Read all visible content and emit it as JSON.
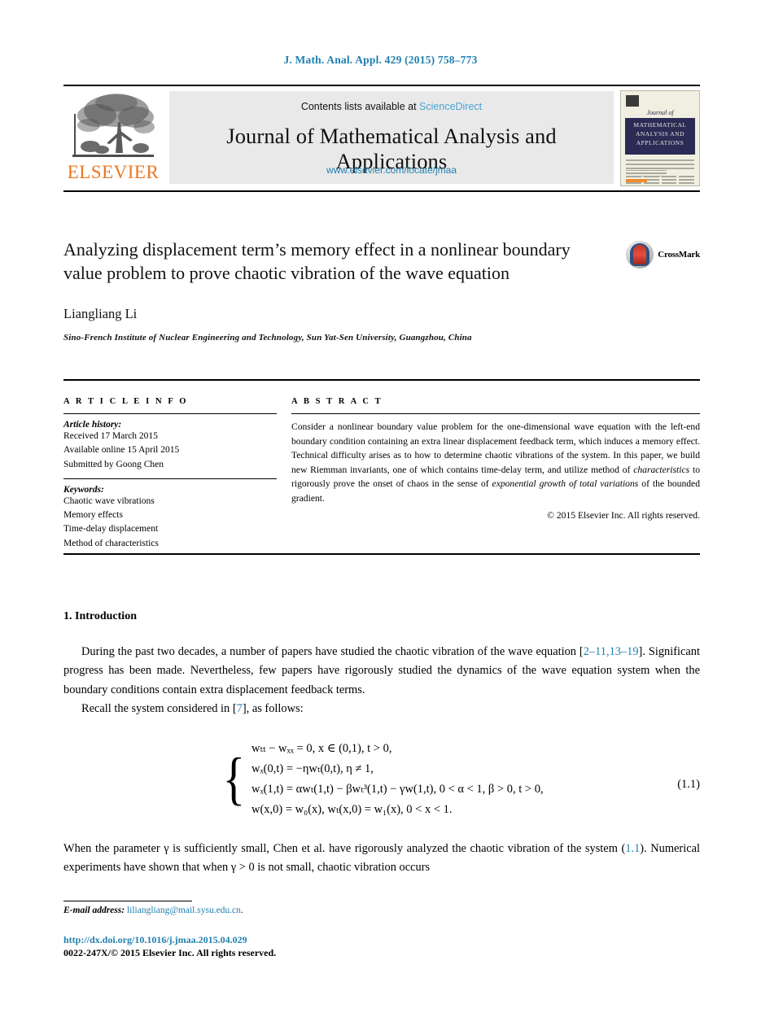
{
  "running_head": "J. Math. Anal. Appl. 429 (2015) 758–773",
  "masthead": {
    "contents_prefix": "Contents lists available at",
    "sciencedirect": "ScienceDirect",
    "journal_title": "Journal of Mathematical Analysis and Applications",
    "journal_url": "www.elsevier.com/locate/jmaa",
    "publisher": "ELSEVIER",
    "cover": {
      "journal_of": "Journal of",
      "band_line1": "MATHEMATICAL",
      "band_line2": "ANALYSIS AND",
      "band_line3": "APPLICATIONS"
    }
  },
  "title_block": {
    "title": "Analyzing displacement term’s memory effect in a nonlinear boundary value problem to prove chaotic vibration of the wave equation",
    "crossmark_label": "CrossMark",
    "author": "Liangliang Li",
    "affiliation": "Sino-French Institute of Nuclear Engineering and Technology, Sun Yat-Sen University, Guangzhou, China"
  },
  "article_info": {
    "heading": "A R T I C L E  I N F O",
    "history_label": "Article history:",
    "received": "Received 17 March 2015",
    "available_online": "Available online 15 April 2015",
    "submitted_by": "Submitted by Goong Chen",
    "keywords_label": "Keywords:",
    "keywords": [
      "Chaotic wave vibrations",
      "Memory effects",
      "Time-delay displacement",
      "Method of characteristics"
    ]
  },
  "abstract": {
    "heading": "A B S T R A C T",
    "text_1": "Consider a nonlinear boundary value problem for the one-dimensional wave equation with the left-end boundary condition containing an extra linear displacement feedback term, which induces a memory effect. Technical difficulty arises as to how to determine chaotic vibrations of the system. In this paper, we build new Riemman invariants, one of which contains time-delay term, and utilize method of ",
    "italic_1": "characteristics",
    "text_2": " to rigorously prove the onset of chaos in the sense of ",
    "italic_2": "exponential growth of total variations",
    "text_3": " of the bounded gradient.",
    "copyright": "© 2015 Elsevier Inc. All rights reserved."
  },
  "body": {
    "section_title": "1.  Introduction",
    "p1_a": "During the past two decades, a number of papers have studied the chaotic vibration of the wave equation [",
    "p1_cite": "2–11,13–19",
    "p1_b": "]. Significant progress has been made. Nevertheless, few papers have rigorously studied the dynamics of the wave equation system when the boundary conditions contain extra displacement feedback terms.",
    "p2_a": "Recall the system considered in [",
    "p2_cite": "7",
    "p2_b": "], as follows:",
    "p3_a": "When the parameter γ is sufficiently small, Chen et al. have rigorously analyzed the chaotic vibration of the system (",
    "p3_cite": "1.1",
    "p3_b": "). Numerical experiments have shown that when γ > 0 is not small, chaotic vibration occurs"
  },
  "equation": {
    "number": "(1.1)",
    "line1": "w",
    "line1_rest": " − w",
    "line1_cond": " = 0,    x ∈ (0,1), t > 0,",
    "lines": [
      "wₜₜ − wₓₓ = 0,    x ∈ (0,1), t > 0,",
      "wₓ(0,t) = −ηwₜ(0,t),    η ≠ 1,",
      "wₓ(1,t) = αwₜ(1,t) − βwₜ³(1,t) − γw(1,t),    0 < α < 1, β > 0, t > 0,",
      "w(x,0) = w₀(x),    wₜ(x,0) = w₁(x),    0 < x < 1."
    ]
  },
  "footer": {
    "email_label": "E-mail address:",
    "email": "liliangliang@mail.sysu.edu.cn",
    "email_period": ".",
    "doi": "http://dx.doi.org/10.1016/j.jmaa.2015.04.029",
    "issn": "0022-247X/© 2015 Elsevier Inc. All rights reserved."
  },
  "colors": {
    "link_blue": "#1f7fb0",
    "sciencedirect_blue": "#4aa4d4",
    "elsevier_orange": "#E87722"
  }
}
